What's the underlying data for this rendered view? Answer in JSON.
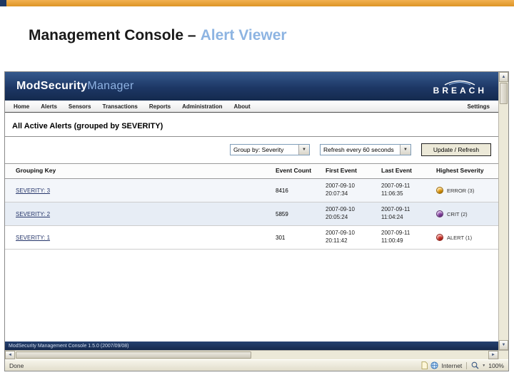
{
  "slide": {
    "title_main": "Management Console –",
    "title_accent": "Alert Viewer"
  },
  "browser": {
    "header": {
      "logo_part1": "ModSecurity",
      "logo_part2": "Manager",
      "brand": "BREACH"
    },
    "nav": {
      "items": [
        "Home",
        "Alerts",
        "Sensors",
        "Transactions",
        "Reports",
        "Administration",
        "About"
      ],
      "right_item": "Settings"
    },
    "page": {
      "heading": "All Active Alerts (grouped by SEVERITY)",
      "toolbar": {
        "group_by": "Group by: Severity",
        "refresh": "Refresh every 60 seconds",
        "update_button": "Update / Refresh"
      },
      "table": {
        "columns": [
          "Grouping Key",
          "Event Count",
          "First Event",
          "Last Event",
          "Highest Severity"
        ],
        "rows": [
          {
            "key": "SEVERITY: 3",
            "count": "8416",
            "first_date": "2007-09-10",
            "first_time": "20:07:34",
            "last_date": "2007-09-11",
            "last_time": "11:06:35",
            "severity": "ERROR (3)",
            "color": "#f0a30a"
          },
          {
            "key": "SEVERITY: 2",
            "count": "5859",
            "first_date": "2007-09-10",
            "first_time": "20:05:24",
            "last_date": "2007-09-11",
            "last_time": "11:04:24",
            "severity": "CRIT (2)",
            "color": "#8e44ad"
          },
          {
            "key": "SEVERITY: 1",
            "count": "301",
            "first_date": "2007-09-10",
            "first_time": "20:11:42",
            "last_date": "2007-09-11",
            "last_time": "11:00:49",
            "severity": "ALERT (1)",
            "color": "#d93025"
          }
        ]
      },
      "footer": "ModSecurity Management Console 1.5.0 (2007/09/08)"
    },
    "statusbar": {
      "status": "Done",
      "zone": "Internet",
      "zoom": "100%"
    }
  }
}
